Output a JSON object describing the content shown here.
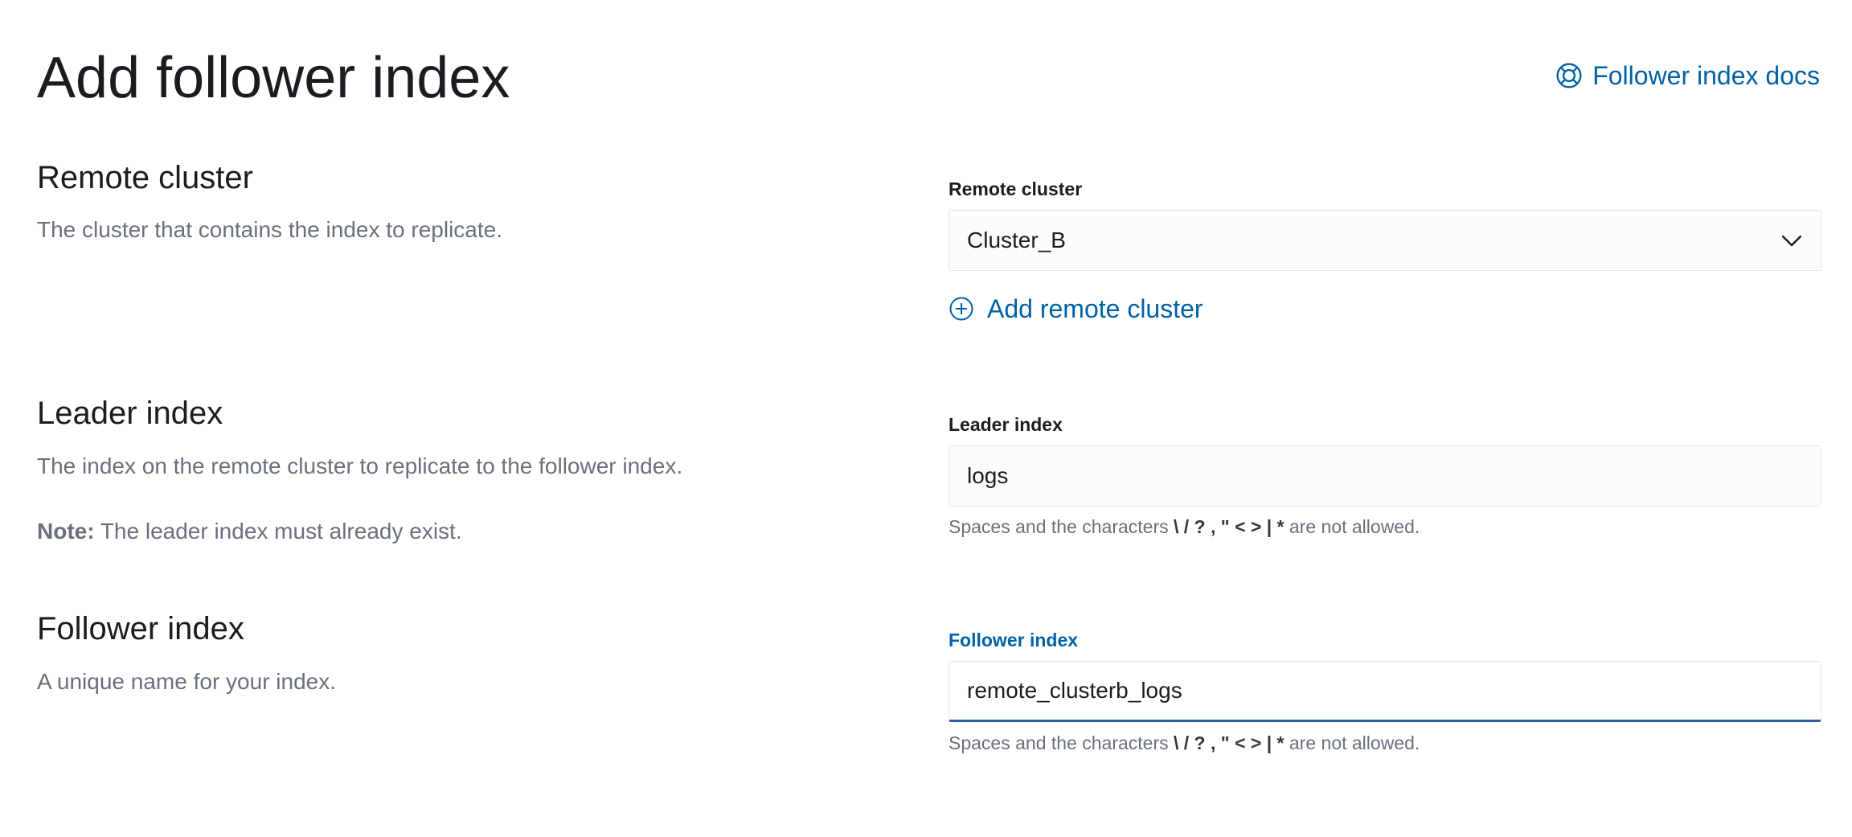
{
  "page": {
    "title": "Add follower index",
    "docs_link": "Follower index docs"
  },
  "remote_cluster": {
    "title": "Remote cluster",
    "description": "The cluster that contains the index to replicate.",
    "field_label": "Remote cluster",
    "selected_value": "Cluster_B",
    "add_link": "Add remote cluster"
  },
  "leader_index": {
    "title": "Leader index",
    "description": "The index on the remote cluster to replicate to the follower index.",
    "note_label": "Note:",
    "note_text": " The leader index must already exist.",
    "field_label": "Leader index",
    "value": "logs",
    "help_prefix": "Spaces and the characters ",
    "help_chars": "\\ / ? , \" < > | *",
    "help_suffix": " are not allowed."
  },
  "follower_index": {
    "title": "Follower index",
    "description": "A unique name for your index.",
    "field_label": "Follower index",
    "value": "remote_clusterb_logs",
    "help_prefix": "Spaces and the characters ",
    "help_chars": "\\ / ? , \" < > | *",
    "help_suffix": " are not allowed."
  },
  "colors": {
    "link": "#0061a6",
    "focus_border": "#2b5ea8",
    "subdued_text": "#69707d"
  },
  "icons": {
    "docs": "help-lifebuoy-icon",
    "chevron": "chevron-down-icon",
    "add": "plus-in-circle-icon"
  }
}
